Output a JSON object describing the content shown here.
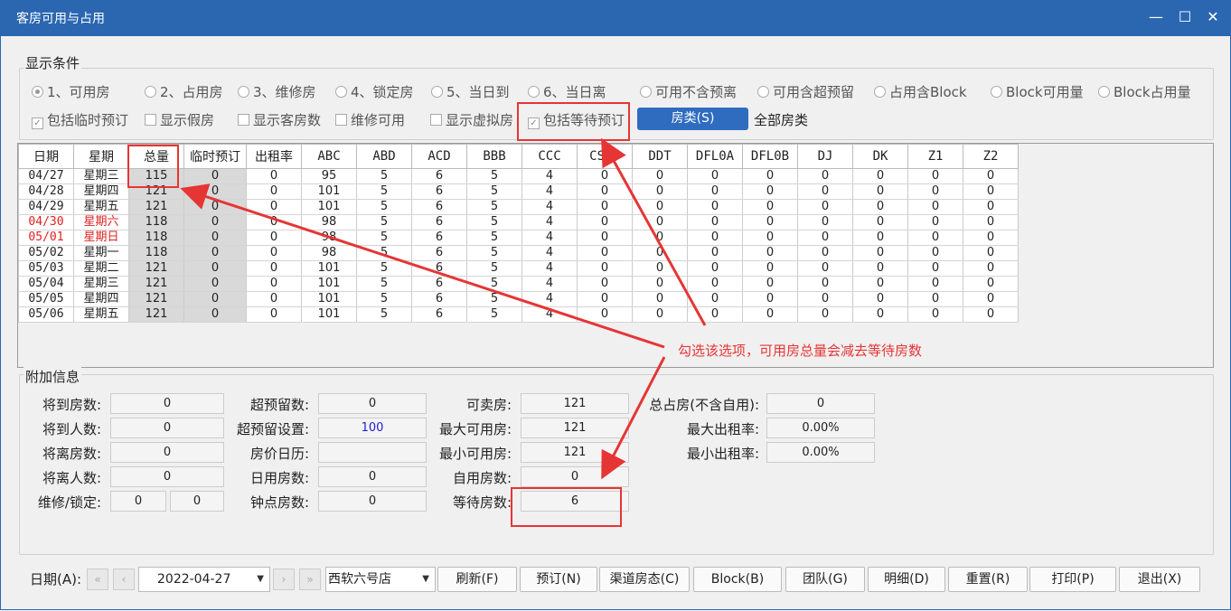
{
  "window": {
    "title": "客房可用与占用",
    "min_icon": "minimize-icon",
    "max_icon": "maximize-icon",
    "close_icon": "close-icon"
  },
  "conditions": {
    "title": "显示条件",
    "radios": [
      {
        "label": "1、可用房",
        "selected": true
      },
      {
        "label": "2、占用房",
        "selected": false
      },
      {
        "label": "3、维修房",
        "selected": false
      },
      {
        "label": "4、锁定房",
        "selected": false
      },
      {
        "label": "5、当日到",
        "selected": false
      },
      {
        "label": "6、当日离",
        "selected": false
      },
      {
        "label": "可用不含预离",
        "selected": false
      },
      {
        "label": "可用含超预留",
        "selected": false
      },
      {
        "label": "占用含Block",
        "selected": false
      },
      {
        "label": "Block可用量",
        "selected": false
      },
      {
        "label": "Block占用量",
        "selected": false
      }
    ],
    "checks": [
      {
        "label": "包括临时预订",
        "checked": true
      },
      {
        "label": "显示假房",
        "checked": false
      },
      {
        "label": "显示客房数",
        "checked": false
      },
      {
        "label": "维修可用",
        "checked": false
      },
      {
        "label": "显示虚拟房",
        "checked": false
      },
      {
        "label": "包括等待预订",
        "checked": true
      }
    ],
    "room_type_button": "房类(S)",
    "room_type_value": "全部房类"
  },
  "grid": {
    "columns": [
      "日期",
      "星期",
      "总量",
      "临时预订",
      "出租率",
      "ABC",
      "ABD",
      "ACD",
      "BBB",
      "CCC",
      "CSFD",
      "DDT",
      "DFL0A",
      "DFL0B",
      "DJ",
      "DK",
      "Z1",
      "Z2"
    ],
    "rows": [
      {
        "date": "04/27",
        "weekday": "星期三",
        "weekend": false,
        "total": "115",
        "temp": "0",
        "rate": "0",
        "v": [
          "95",
          "5",
          "6",
          "5",
          "4",
          "0",
          "0",
          "0",
          "0",
          "0",
          "0",
          "0",
          "0"
        ]
      },
      {
        "date": "04/28",
        "weekday": "星期四",
        "weekend": false,
        "total": "121",
        "temp": "0",
        "rate": "0",
        "v": [
          "101",
          "5",
          "6",
          "5",
          "4",
          "0",
          "0",
          "0",
          "0",
          "0",
          "0",
          "0",
          "0"
        ]
      },
      {
        "date": "04/29",
        "weekday": "星期五",
        "weekend": false,
        "total": "121",
        "temp": "0",
        "rate": "0",
        "v": [
          "101",
          "5",
          "6",
          "5",
          "4",
          "0",
          "0",
          "0",
          "0",
          "0",
          "0",
          "0",
          "0"
        ]
      },
      {
        "date": "04/30",
        "weekday": "星期六",
        "weekend": true,
        "total": "118",
        "temp": "0",
        "rate": "0",
        "v": [
          "98",
          "5",
          "6",
          "5",
          "4",
          "0",
          "0",
          "0",
          "0",
          "0",
          "0",
          "0",
          "0"
        ]
      },
      {
        "date": "05/01",
        "weekday": "星期日",
        "weekend": true,
        "total": "118",
        "temp": "0",
        "rate": "0",
        "v": [
          "98",
          "5",
          "6",
          "5",
          "4",
          "0",
          "0",
          "0",
          "0",
          "0",
          "0",
          "0",
          "0"
        ]
      },
      {
        "date": "05/02",
        "weekday": "星期一",
        "weekend": false,
        "total": "118",
        "temp": "0",
        "rate": "0",
        "v": [
          "98",
          "5",
          "6",
          "5",
          "4",
          "0",
          "0",
          "0",
          "0",
          "0",
          "0",
          "0",
          "0"
        ]
      },
      {
        "date": "05/03",
        "weekday": "星期二",
        "weekend": false,
        "total": "121",
        "temp": "0",
        "rate": "0",
        "v": [
          "101",
          "5",
          "6",
          "5",
          "4",
          "0",
          "0",
          "0",
          "0",
          "0",
          "0",
          "0",
          "0"
        ]
      },
      {
        "date": "05/04",
        "weekday": "星期三",
        "weekend": false,
        "total": "121",
        "temp": "0",
        "rate": "0",
        "v": [
          "101",
          "5",
          "6",
          "5",
          "4",
          "0",
          "0",
          "0",
          "0",
          "0",
          "0",
          "0",
          "0"
        ]
      },
      {
        "date": "05/05",
        "weekday": "星期四",
        "weekend": false,
        "total": "121",
        "temp": "0",
        "rate": "0",
        "v": [
          "101",
          "5",
          "6",
          "5",
          "4",
          "0",
          "0",
          "0",
          "0",
          "0",
          "0",
          "0",
          "0"
        ]
      },
      {
        "date": "05/06",
        "weekday": "星期五",
        "weekend": false,
        "total": "121",
        "temp": "0",
        "rate": "0",
        "v": [
          "101",
          "5",
          "6",
          "5",
          "4",
          "0",
          "0",
          "0",
          "0",
          "0",
          "0",
          "0",
          "0"
        ]
      }
    ]
  },
  "extra": {
    "title": "附加信息",
    "fields": {
      "arrive_rooms": {
        "label": "将到房数:",
        "value": "0"
      },
      "arrive_people": {
        "label": "将到人数:",
        "value": "0"
      },
      "depart_rooms": {
        "label": "将离房数:",
        "value": "0"
      },
      "depart_people": {
        "label": "将离人数:",
        "value": "0"
      },
      "repair_lock": {
        "label": "维修/锁定:",
        "value1": "0",
        "value2": "0"
      },
      "overbook_count": {
        "label": "超预留数:",
        "value": "0"
      },
      "overbook_setting": {
        "label": "超预留设置:",
        "value": "100"
      },
      "price_calendar": {
        "label": "房价日历:",
        "value": ""
      },
      "dayuse_rooms": {
        "label": "日用房数:",
        "value": "0"
      },
      "hourly_rooms": {
        "label": "钟点房数:",
        "value": "0"
      },
      "sellable": {
        "label": "可卖房:",
        "value": "121"
      },
      "max_avail": {
        "label": "最大可用房:",
        "value": "121"
      },
      "min_avail": {
        "label": "最小可用房:",
        "value": "121"
      },
      "self_use": {
        "label": "自用房数:",
        "value": "0"
      },
      "waiting": {
        "label": "等待房数:",
        "value": "6"
      },
      "total_occupied": {
        "label": "总占房(不含自用):",
        "value": "0"
      },
      "max_rate": {
        "label": "最大出租率:",
        "value": "0.00%"
      },
      "min_rate": {
        "label": "最小出租率:",
        "value": "0.00%"
      }
    }
  },
  "annotation": {
    "text": "勾选该选项，可用房总量会减去等待房数",
    "color": "#e63535"
  },
  "bottom": {
    "date_label": "日期(A):",
    "date_value": "2022-04-27",
    "hotel_value": "西软六号店",
    "buttons": [
      "刷新(F)",
      "预订(N)",
      "渠道房态(C)",
      "Block(B)",
      "团队(G)",
      "明细(D)",
      "重置(R)",
      "打印(P)",
      "退出(X)"
    ]
  },
  "colors": {
    "titlebar": "#2b67b1",
    "accent_button": "#2f6cc0",
    "weekend_red": "#e02020",
    "highlight": "#e63535"
  }
}
